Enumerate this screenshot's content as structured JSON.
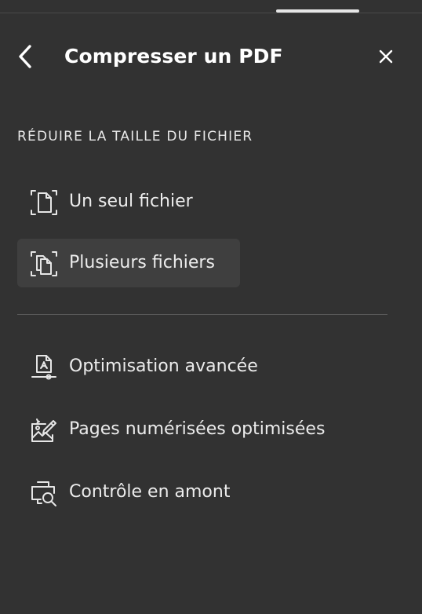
{
  "header": {
    "title": "Compresser un PDF",
    "back_icon": "chevron-left-icon",
    "close_icon": "close-icon"
  },
  "section": {
    "label": "RÉDUIRE LA TAILLE DU FICHIER"
  },
  "reduce_items": [
    {
      "label": "Un seul fichier",
      "icon": "single-file-icon",
      "selected": false
    },
    {
      "label": "Plusieurs fichiers",
      "icon": "multiple-files-icon",
      "selected": true
    }
  ],
  "other_items": [
    {
      "label": "Optimisation avancée",
      "icon": "pdf-optimize-icon"
    },
    {
      "label": "Pages numérisées optimisées",
      "icon": "scanned-image-icon"
    },
    {
      "label": "Contrôle en amont",
      "icon": "preflight-icon"
    }
  ],
  "colors": {
    "background": "#323232",
    "selected_item": "#3f3f3f",
    "text": "#ffffff",
    "divider": "#5a5a5a"
  }
}
